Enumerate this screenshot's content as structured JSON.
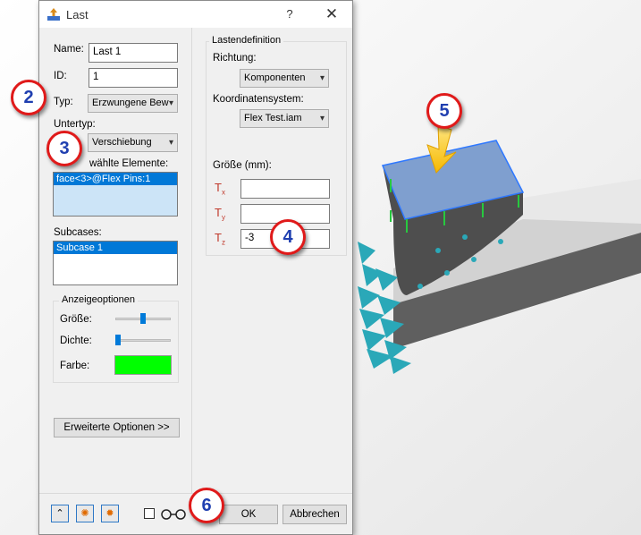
{
  "dialog": {
    "title": "Last",
    "help_glyph": "?",
    "close_glyph": "✕"
  },
  "left": {
    "name_label": "Name:",
    "name_value": "Last 1",
    "id_label": "ID:",
    "id_value": "1",
    "typ_label": "Typ:",
    "typ_value": "Erzwungene Bew",
    "untertyp_label": "Untertyp:",
    "untertyp_value": "Verschiebung",
    "selected_label": "wählte Elemente:",
    "selected_items": [
      "face<3>@Flex Pins:1"
    ],
    "subcases_label": "Subcases:",
    "subcases_items": [
      "Subcase 1"
    ],
    "display_group_title": "Anzeigeoptionen",
    "size_label": "Größe:",
    "size_level": 0.5,
    "density_label": "Dichte:",
    "density_level": 0.0,
    "color_label": "Farbe:",
    "color_value": "#00ff00",
    "advanced_button": "Erweiterte Optionen >>"
  },
  "right": {
    "group_title": "Lastendefinition",
    "direction_label": "Richtung:",
    "direction_value": "Komponenten",
    "coord_label": "Koordinatensystem:",
    "coord_value": "Flex Test.iam",
    "size_label": "Größe (mm):",
    "tx_main": "T",
    "tx_sub": "x",
    "tx_value": "",
    "ty_main": "T",
    "ty_sub": "y",
    "ty_value": "",
    "tz_main": "T",
    "tz_sub": "z",
    "tz_value": "-3"
  },
  "footer": {
    "ok_button": "OK",
    "cancel_button": "Abbrechen",
    "checkbox_checked": false
  },
  "callouts": [
    "2",
    "3",
    "4",
    "5",
    "6"
  ],
  "colors": {
    "accent_blue": "#0078d7",
    "callout_border": "#e01a1a",
    "callout_text": "#1f3fb0",
    "t_label_red": "#c0392b",
    "model_gray": "#5a5a5a",
    "selected_face": "#7f9fcf",
    "arrow_yellow": "#f7c520",
    "cone_teal": "#2aa8b8"
  }
}
